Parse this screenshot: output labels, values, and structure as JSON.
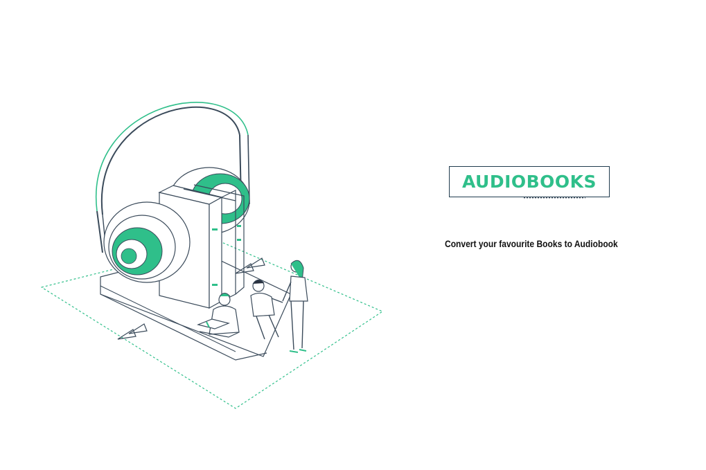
{
  "brand": {
    "logo_text": "AUDIOBOOKS",
    "tagline": "Convert your favourite Books to Audiobook"
  },
  "colors": {
    "accent": "#2fbf8a",
    "outline": "#3a4a5a",
    "logo_border": "#1f3a4d",
    "text": "#111111",
    "background": "#ffffff"
  },
  "icons": {
    "hero": "headphones-books-illustration",
    "arrow_right": "double-chevron-right-icon",
    "arrow_left": "double-chevron-left-icon"
  }
}
